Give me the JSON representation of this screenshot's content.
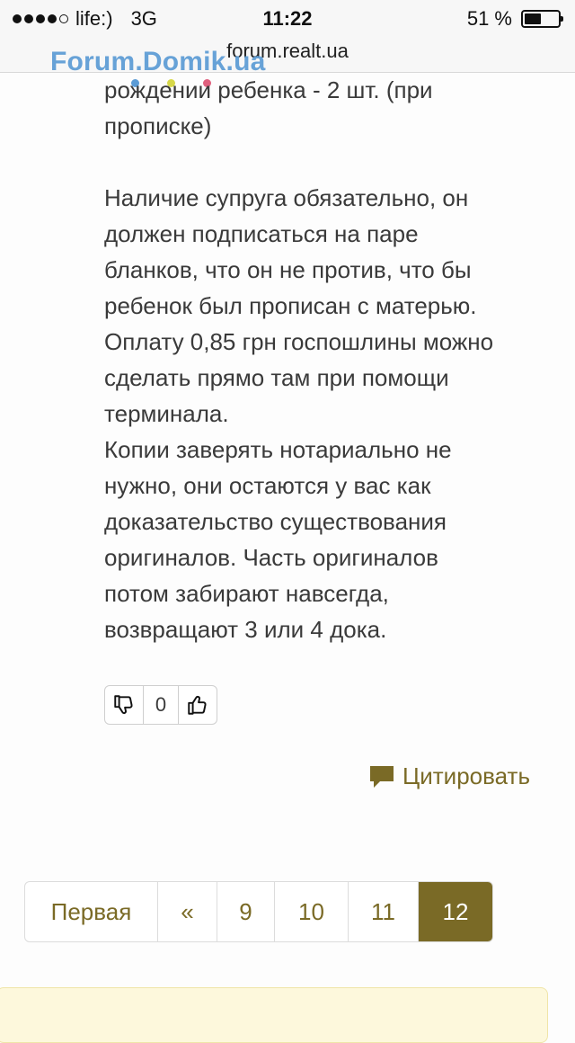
{
  "status_bar": {
    "carrier": "life:)",
    "network": "3G",
    "time": "11:22",
    "battery_percent_label": "51 %",
    "battery_level": 0.51,
    "signal_bars_filled": 4,
    "signal_bars_total": 5
  },
  "browser": {
    "url": "forum.realt.ua"
  },
  "logo": {
    "text": "Forum.Domik.ua",
    "dot_colors": [
      "#5b9bd5",
      "#d7d84a",
      "#e0607e"
    ]
  },
  "post": {
    "paragraphs": [
      "рождении ребенка - 2 шт. (при\nпрописке)",
      "Наличие супруга обязательно, он\nдолжен подписаться на паре\nбланков, что он не против, что бы\nребенок был прописан с матерью.\nОплату 0,85 грн госпошлины можно\nсделать прямо там при помощи\nтерминала.\nКопии заверять нотариально не\nнужно, они остаются у вас как\nдоказательство существования\nоригиналов. Часть оригиналов\nпотом забирают навсегда,\nвозвращают 3 или 4 дока."
    ]
  },
  "rating": {
    "count": "0",
    "dislike_icon": "thumbs-down-icon",
    "like_icon": "thumbs-up-icon"
  },
  "quote": {
    "label": "Цитировать",
    "icon": "speech-bubble-icon"
  },
  "pagination": {
    "pages": [
      {
        "label": "Первая",
        "active": false
      },
      {
        "label": "«",
        "active": false
      },
      {
        "label": "9",
        "active": false
      },
      {
        "label": "10",
        "active": false
      },
      {
        "label": "11",
        "active": false
      },
      {
        "label": "12",
        "active": true
      }
    ]
  },
  "colors": {
    "accent": "#7a6a26",
    "notice_bg": "#fdf8dc",
    "logo": "#5b9bd5"
  }
}
